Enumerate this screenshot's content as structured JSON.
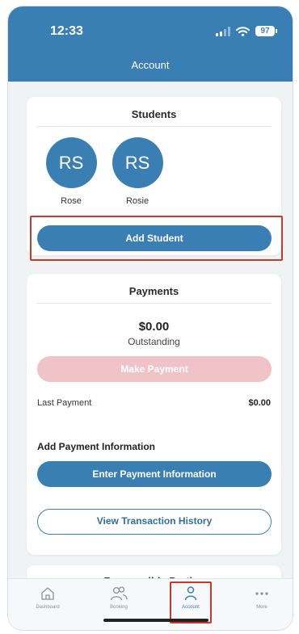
{
  "status_bar": {
    "time": "12:33",
    "battery": "97"
  },
  "header": {
    "title": "Account"
  },
  "students": {
    "title": "Students",
    "list": [
      {
        "initials": "RS",
        "name": "Rose"
      },
      {
        "initials": "RS",
        "name": "Rosie"
      }
    ],
    "add_button": "Add Student"
  },
  "payments": {
    "title": "Payments",
    "amount": "$0.00",
    "amount_label": "Outstanding",
    "make_payment_button": "Make Payment",
    "last_payment_label": "Last Payment",
    "last_payment_value": "$0.00",
    "add_payment_info_heading": "Add Payment Information",
    "enter_payment_button": "Enter Payment Information",
    "history_button": "View Transaction History"
  },
  "next_card": {
    "title": "Responsible Parties"
  },
  "tabbar": {
    "items": [
      {
        "label": "Dashboard",
        "icon": "home-icon"
      },
      {
        "label": "Booking",
        "icon": "people-icon"
      },
      {
        "label": "Account",
        "icon": "person-icon",
        "active": true
      },
      {
        "label": "More",
        "icon": "more-icon"
      }
    ]
  },
  "colors": {
    "primary": "#3a7fb3",
    "disabled_button": "#efc3c7",
    "highlight_box": "#c6392c"
  }
}
